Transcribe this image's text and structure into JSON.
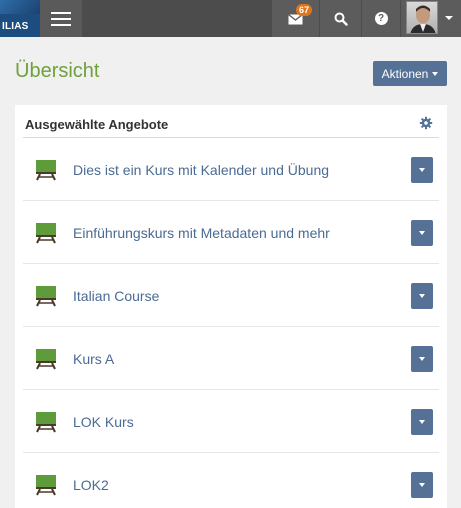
{
  "header": {
    "logo_text": "ILIAS",
    "mail_badge": "67",
    "icons": {
      "menu": "hamburger-icon",
      "mail": "mail-icon",
      "search": "search-icon",
      "help": "help-icon",
      "user": "avatar"
    }
  },
  "page": {
    "title": "Übersicht",
    "actions_label": "Aktionen"
  },
  "panel": {
    "title": "Ausgewählte Angebote",
    "settings_icon": "gear-icon",
    "items": [
      {
        "label": "Dies ist ein Kurs mit Kalender und Übung",
        "icon": "course-icon"
      },
      {
        "label": "Einführungskurs mit Metadaten und mehr",
        "icon": "course-icon"
      },
      {
        "label": "Italian Course",
        "icon": "course-icon"
      },
      {
        "label": "Kurs A",
        "icon": "course-icon"
      },
      {
        "label": "LOK Kurs",
        "icon": "course-icon"
      },
      {
        "label": "LOK2",
        "icon": "course-icon"
      }
    ]
  },
  "colors": {
    "topbar": "#4c4c4c",
    "accent_green": "#6ea03c",
    "button_blue": "#557196",
    "link_blue": "#4a6b93",
    "badge_orange": "#e0761b"
  }
}
